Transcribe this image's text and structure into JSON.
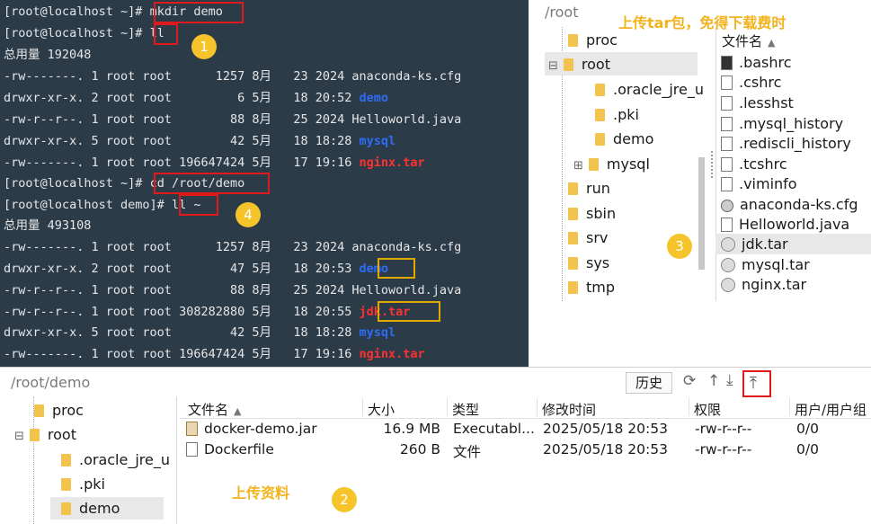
{
  "terminal": {
    "lines": [
      {
        "prompt": "[root@localhost ~]# ",
        "cmd": "mkdir demo"
      },
      {
        "prompt": "[root@localhost ~]# ",
        "cmd": "ll"
      },
      {
        "text": "总用量 192048"
      },
      {
        "perm": "-rw-------. 1 root root      1257 8月   23 2024 ",
        "name": "anaconda-ks.cfg"
      },
      {
        "perm": "drwxr-xr-x. 2 root root         6 5月   18 20:52 ",
        "name": "demo"
      },
      {
        "perm": "-rw-r--r--. 1 root root        88 8月   25 2024 ",
        "name": "Helloworld.java"
      },
      {
        "perm": "drwxr-xr-x. 5 root root        42 5月   18 18:28 ",
        "name": "mysql"
      },
      {
        "perm": "-rw-------. 1 root root 196647424 5月   17 19:16 ",
        "name": "nginx.tar"
      },
      {
        "prompt": "[root@localhost ~]# ",
        "cmd": "cd /root/demo"
      },
      {
        "prompt": "[root@localhost demo]# ",
        "cmd": "ll ~"
      },
      {
        "text": "总用量 493108"
      },
      {
        "perm": "-rw-------. 1 root root      1257 8月   23 2024 ",
        "name": "anaconda-ks.cfg"
      },
      {
        "perm": "drwxr-xr-x. 2 root root        47 5月   18 20:53 ",
        "name": "demo"
      },
      {
        "perm": "-rw-r--r--. 1 root root        88 8月   25 2024 ",
        "name": "Helloworld.java"
      },
      {
        "perm": "-rw-r--r--. 1 root root 308282880 5月   18 20:55 ",
        "name": "jdk.tar"
      },
      {
        "perm": "drwxr-xr-x. 5 root root        42 5月   18 18:28 ",
        "name": "mysql"
      },
      {
        "perm": "-rw-------. 1 root root 196647424 5月   17 19:16 ",
        "name": "nginx.tar"
      }
    ],
    "colors": {
      "dir": "#2f6cf5",
      "archive": "#ff3030",
      "background": "#2b3b48"
    }
  },
  "badges": {
    "one": "1",
    "two": "2",
    "three": "3",
    "four": "4"
  },
  "remote": {
    "path": "/root",
    "annotation": "上传tar包，免得下载费时",
    "tree": [
      {
        "label": "proc"
      },
      {
        "label": "root"
      },
      {
        "label": ".oracle_jre_u"
      },
      {
        "label": ".pki"
      },
      {
        "label": "demo"
      },
      {
        "label": "mysql"
      },
      {
        "label": "run"
      },
      {
        "label": "sbin"
      },
      {
        "label": "srv"
      },
      {
        "label": "sys"
      },
      {
        "label": "tmp"
      }
    ],
    "expand_icon": "⊞",
    "collapse_icon": "⊟",
    "files_header": "文件名",
    "files": [
      ".bashrc",
      ".cshrc",
      ".lesshst",
      ".mysql_history",
      ".rediscli_history",
      ".tcshrc",
      ".viminfo",
      "anaconda-ks.cfg",
      "Helloworld.java",
      "jdk.tar",
      "mysql.tar",
      "nginx.tar"
    ]
  },
  "local": {
    "path": "/root/demo",
    "history_button": "历史",
    "annotation": "上传资料",
    "tree": [
      {
        "label": "proc"
      },
      {
        "label": "root"
      },
      {
        "label": ".oracle_jre_u"
      },
      {
        "label": ".pki"
      },
      {
        "label": "demo"
      }
    ],
    "columns": [
      "文件名",
      "大小",
      "类型",
      "修改时间",
      "权限",
      "用户/用户组"
    ],
    "rows": [
      {
        "name": "docker-demo.jar",
        "size": "16.9 MB",
        "type": "Executabl...",
        "mtime": "2025/05/18 20:53",
        "perm": "-rw-r--r--",
        "owner": "0/0"
      },
      {
        "name": "Dockerfile",
        "size": "260 B",
        "type": "文件",
        "mtime": "2025/05/18 20:53",
        "perm": "-rw-r--r--",
        "owner": "0/0"
      }
    ]
  }
}
